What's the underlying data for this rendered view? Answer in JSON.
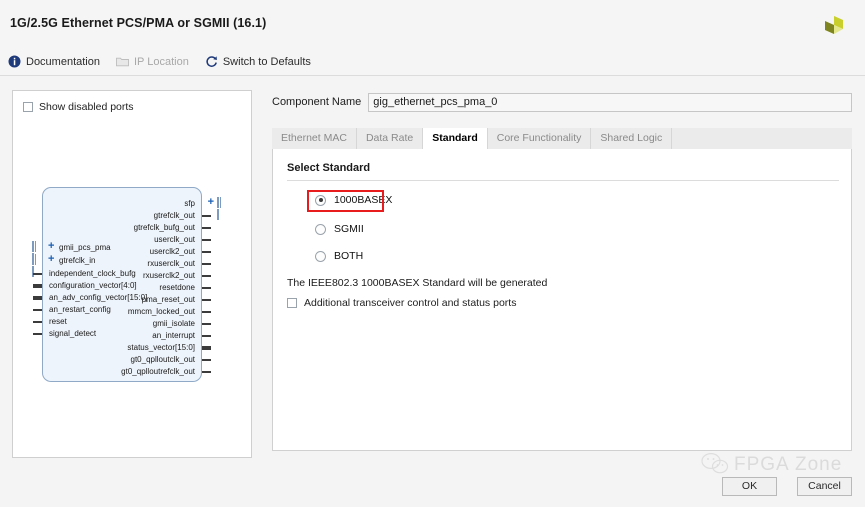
{
  "header": {
    "title": "1G/2.5G Ethernet PCS/PMA or SGMII (16.1)",
    "logo_icon": "xilinx-pinwheel-logo",
    "toolbar": [
      {
        "label": "Documentation",
        "icon": "info-icon",
        "disabled": false
      },
      {
        "label": "IP Location",
        "icon": "folder-icon",
        "disabled": true
      },
      {
        "label": "Switch to Defaults",
        "icon": "refresh-icon",
        "disabled": false
      }
    ]
  },
  "left_panel": {
    "show_disabled_ports": {
      "label": "Show disabled ports",
      "checked": false
    },
    "symbol": {
      "inputs": [
        {
          "name": "gmii_pcs_pma",
          "type": "bus-expandable"
        },
        {
          "name": "gtrefclk_in",
          "type": "bus-expandable"
        },
        {
          "name": "independent_clock_bufg",
          "type": "single"
        },
        {
          "name": "configuration_vector[4:0]",
          "type": "bus"
        },
        {
          "name": "an_adv_config_vector[15:0]",
          "type": "bus"
        },
        {
          "name": "an_restart_config",
          "type": "single"
        },
        {
          "name": "reset",
          "type": "single"
        },
        {
          "name": "signal_detect",
          "type": "single"
        }
      ],
      "outputs": [
        {
          "name": "sfp",
          "type": "bus-expandable"
        },
        {
          "name": "gtrefclk_out",
          "type": "single"
        },
        {
          "name": "gtrefclk_bufg_out",
          "type": "single"
        },
        {
          "name": "userclk_out",
          "type": "single"
        },
        {
          "name": "userclk2_out",
          "type": "single"
        },
        {
          "name": "rxuserclk_out",
          "type": "single"
        },
        {
          "name": "rxuserclk2_out",
          "type": "single"
        },
        {
          "name": "resetdone",
          "type": "single"
        },
        {
          "name": "pma_reset_out",
          "type": "single"
        },
        {
          "name": "mmcm_locked_out",
          "type": "single"
        },
        {
          "name": "gmii_isolate",
          "type": "single"
        },
        {
          "name": "an_interrupt",
          "type": "single"
        },
        {
          "name": "status_vector[15:0]",
          "type": "bus"
        },
        {
          "name": "gt0_qplloutclk_out",
          "type": "single"
        },
        {
          "name": "gt0_qplloutrefclk_out",
          "type": "single"
        }
      ]
    }
  },
  "main": {
    "component_name": {
      "label": "Component Name",
      "value": "gig_ethernet_pcs_pma_0"
    },
    "tabs": [
      {
        "label": "Ethernet MAC",
        "active": false
      },
      {
        "label": "Data Rate",
        "active": false
      },
      {
        "label": "Standard",
        "active": true
      },
      {
        "label": "Core Functionality",
        "active": false
      },
      {
        "label": "Shared Logic",
        "active": false
      }
    ],
    "section_title": "Select Standard",
    "standard_options": [
      {
        "label": "1000BASEX",
        "selected": true
      },
      {
        "label": "SGMII",
        "selected": false
      },
      {
        "label": "BOTH",
        "selected": false
      }
    ],
    "description": "The IEEE802.3 1000BASEX Standard will be generated",
    "additional_ports": {
      "label": "Additional transceiver control and status ports",
      "checked": false
    },
    "highlight_color": "#e81c1c"
  },
  "footer": {
    "ok_label": "OK",
    "cancel_label": "Cancel"
  },
  "watermark": {
    "text": "FPGA Zone",
    "icon": "wechat-icon"
  }
}
